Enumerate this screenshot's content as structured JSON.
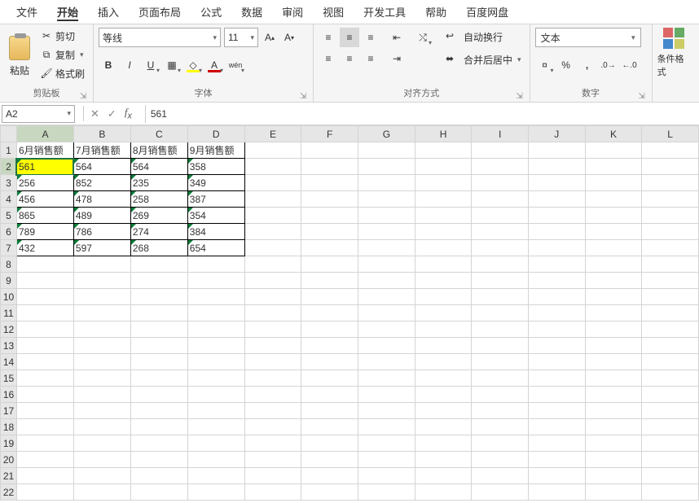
{
  "menu": {
    "file": "文件",
    "home": "开始",
    "insert": "插入",
    "page_layout": "页面布局",
    "formulas": "公式",
    "data": "数据",
    "review": "审阅",
    "view": "视图",
    "developer": "开发工具",
    "help": "帮助",
    "baidu": "百度网盘"
  },
  "ribbon": {
    "clipboard": {
      "paste": "粘贴",
      "cut": "剪切",
      "copy": "复制",
      "format_painter": "格式刷",
      "group_label": "剪贴板"
    },
    "font": {
      "name": "等线",
      "size": "11",
      "group_label": "字体",
      "wen": "wén"
    },
    "alignment": {
      "wrap_text": "自动换行",
      "merge_center": "合并后居中",
      "group_label": "对齐方式"
    },
    "number": {
      "format": "文本",
      "group_label": "数字"
    },
    "cond_fmt": "条件格式"
  },
  "name_box": "A2",
  "formula_value": "561",
  "columns": [
    "A",
    "B",
    "C",
    "D",
    "E",
    "F",
    "G",
    "H",
    "I",
    "J",
    "K",
    "L"
  ],
  "row_count": 22,
  "active_cell": {
    "row": 2,
    "col": "A"
  },
  "chart_data": {
    "type": "table",
    "headers": [
      "6月销售额",
      "7月销售额",
      "8月销售额",
      "9月销售额"
    ],
    "rows": [
      [
        561,
        564,
        564,
        358
      ],
      [
        256,
        852,
        235,
        349
      ],
      [
        456,
        478,
        258,
        387
      ],
      [
        865,
        489,
        269,
        354
      ],
      [
        789,
        786,
        274,
        384
      ],
      [
        432,
        597,
        268,
        654
      ]
    ]
  }
}
